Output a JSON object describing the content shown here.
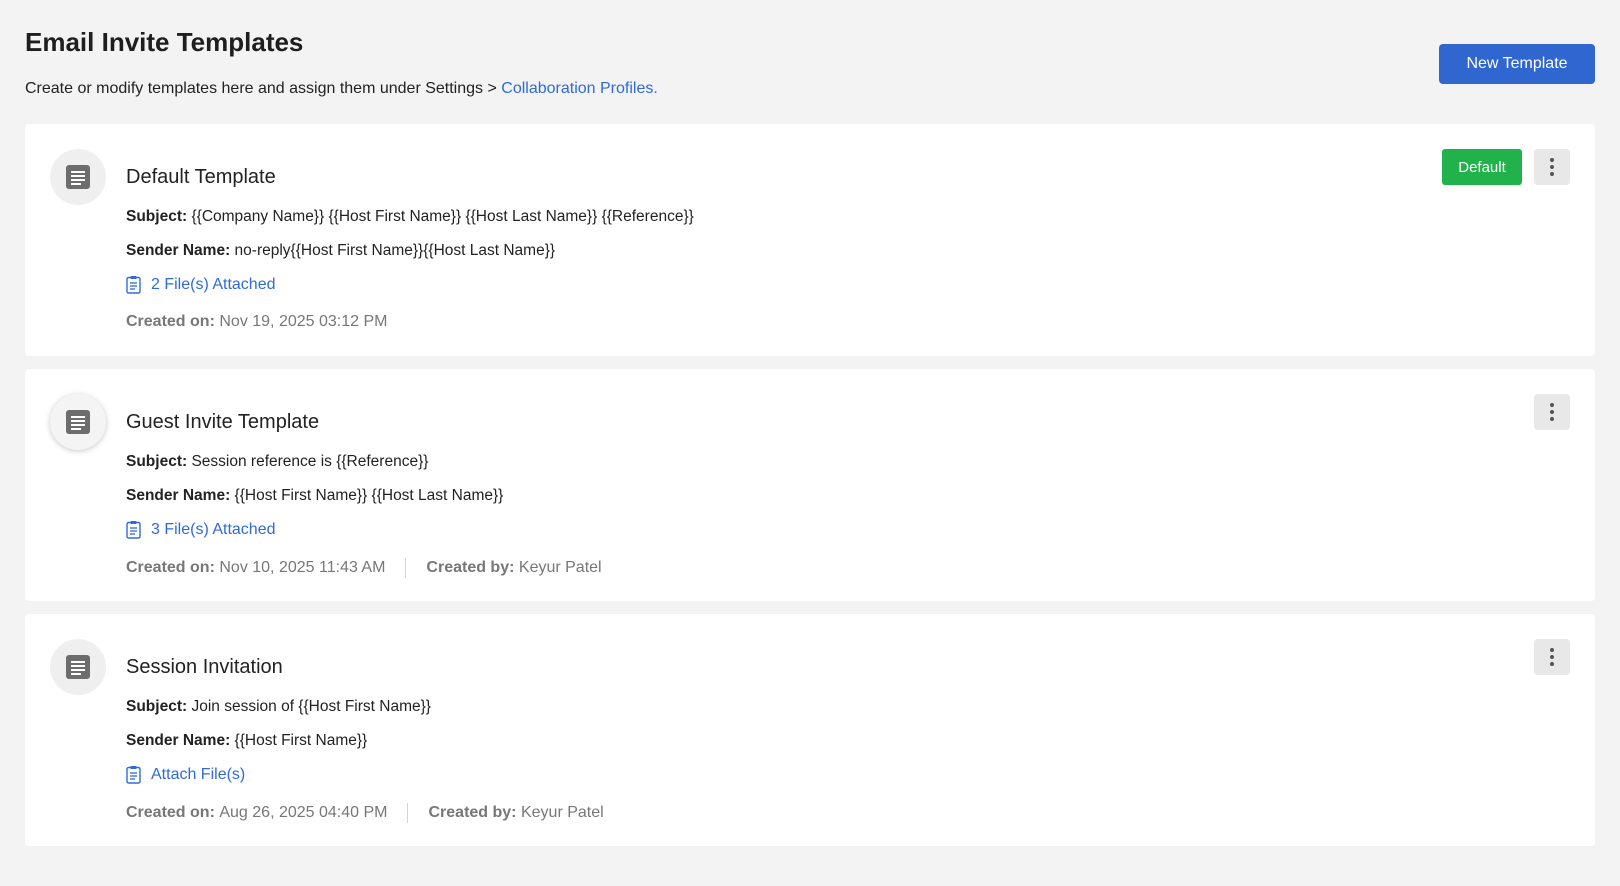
{
  "header": {
    "title": "Email Invite Templates",
    "description": "Create or modify templates here and assign them under Settings > ",
    "link_text": "Collaboration Profiles.",
    "new_button": "New Template"
  },
  "labels": {
    "subject": "Subject:",
    "sender": "Sender Name:",
    "created_on": "Created on:",
    "created_by": "Created by:",
    "default_badge": "Default"
  },
  "templates": [
    {
      "name": "Default Template",
      "subject": "{{Company Name}} {{Host First Name}} {{Host Last Name}} {{Reference}}",
      "sender": "no-reply{{Host First Name}}{{Host Last Name}}",
      "attachments": "2 File(s) Attached",
      "created_on": "Nov 19, 2025 03:12 PM",
      "created_by": ""
    },
    {
      "name": "Guest Invite Template",
      "subject": "Session reference is {{Reference}}",
      "sender": "{{Host First Name}} {{Host Last Name}}",
      "attachments": "3 File(s) Attached",
      "created_on": "Nov 10, 2025 11:43 AM",
      "created_by": "Keyur Patel"
    },
    {
      "name": "Session Invitation",
      "subject": "Join session of {{Host First Name}}",
      "sender": "{{Host First Name}}",
      "attachments": "Attach File(s)",
      "created_on": "Aug 26, 2025 04:40 PM",
      "created_by": "Keyur Patel"
    }
  ],
  "icons": {
    "template": "document-icon",
    "attachment": "attachment-list-icon",
    "menu": "more-vertical-icon"
  },
  "colors": {
    "primary": "#2f66d0",
    "link": "#2f6bd8",
    "default_badge": "#22b24c",
    "background": "#f3f3f3"
  }
}
